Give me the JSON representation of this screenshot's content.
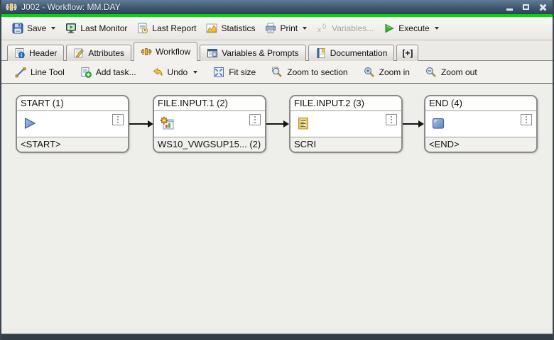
{
  "window": {
    "title": "J002 - Workflow: MM.DAY"
  },
  "toolbar": {
    "items": [
      {
        "label": "Save",
        "icon": "save-icon",
        "dropdown": true,
        "disabled": false
      },
      {
        "label": "Last Monitor",
        "icon": "monitor-icon",
        "dropdown": false,
        "disabled": false
      },
      {
        "label": "Last Report",
        "icon": "report-icon",
        "dropdown": false,
        "disabled": false
      },
      {
        "label": "Statistics",
        "icon": "statistics-icon",
        "dropdown": false,
        "disabled": false
      },
      {
        "label": "Print",
        "icon": "print-icon",
        "dropdown": true,
        "disabled": false
      },
      {
        "label": "Variables...",
        "icon": "variables-icon",
        "dropdown": false,
        "disabled": true
      },
      {
        "label": "Execute",
        "icon": "execute-icon",
        "dropdown": true,
        "disabled": false
      }
    ]
  },
  "tabs": {
    "items": [
      {
        "label": "Header",
        "icon": "header-doc-icon",
        "active": false
      },
      {
        "label": "Attributes",
        "icon": "attributes-pencil-icon",
        "active": false
      },
      {
        "label": "Workflow",
        "icon": "workflow-icon",
        "active": true
      },
      {
        "label": "Variables & Prompts",
        "icon": "variables-prompts-icon",
        "active": false
      },
      {
        "label": "Documentation",
        "icon": "documentation-icon",
        "active": false
      },
      {
        "label": "[+]",
        "icon": "add-tab-icon",
        "active": false
      }
    ]
  },
  "canvas_toolbar": {
    "items": [
      {
        "label": "Line Tool",
        "icon": "line-tool-icon",
        "dropdown": false
      },
      {
        "label": "Add task...",
        "icon": "add-task-icon",
        "dropdown": false
      },
      {
        "label": "Undo",
        "icon": "undo-icon",
        "dropdown": true
      },
      {
        "label": "Fit size",
        "icon": "fit-size-icon",
        "dropdown": false
      },
      {
        "label": "Zoom to section",
        "icon": "zoom-section-icon",
        "dropdown": false
      },
      {
        "label": "Zoom in",
        "icon": "zoom-in-icon",
        "dropdown": false
      },
      {
        "label": "Zoom out",
        "icon": "zoom-out-icon",
        "dropdown": false
      }
    ]
  },
  "workflow": {
    "nodes": [
      {
        "title": "START (1)",
        "footer": "<START>",
        "icon": "start-play-icon"
      },
      {
        "title": "FILE.INPUT.1 (2)",
        "footer": "WS10_VWGSUP15... (2)",
        "icon": "job-gear-icon"
      },
      {
        "title": "FILE.INPUT.2 (3)",
        "footer": "SCRI",
        "icon": "script-icon"
      },
      {
        "title": "END (4)",
        "footer": "<END>",
        "icon": "end-stop-icon"
      }
    ]
  },
  "colors": {
    "titlebar_top": "#617b93",
    "titlebar_bottom": "#2c4156",
    "accent_green": "#00d900",
    "canvas_bg": "#eeeeeb",
    "node_border": "#8a8a8a",
    "edge": "#141414"
  }
}
